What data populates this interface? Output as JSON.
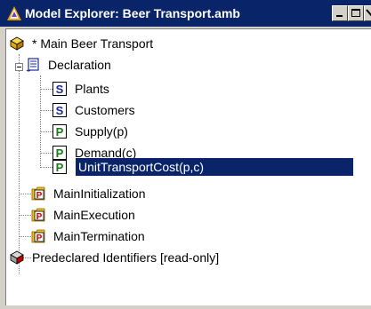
{
  "window": {
    "title": "Model Explorer: Beer Transport.amb",
    "title_icon": "aimms-model-icon"
  },
  "tree": {
    "root": {
      "label": "* Main Beer Transport",
      "icon": "model-box-icon"
    },
    "declaration": {
      "label": "Declaration",
      "icon": "declaration-scroll-icon",
      "expanded": true,
      "items": [
        {
          "label": "Plants",
          "badge": "S",
          "badge_color": "#1b2a9a"
        },
        {
          "label": "Customers",
          "badge": "S",
          "badge_color": "#1b2a9a"
        },
        {
          "label": "Supply(p)",
          "badge": "P",
          "badge_color": "#1a7a1a"
        },
        {
          "label": "Demand(c)",
          "badge": "P",
          "badge_color": "#1a7a1a"
        },
        {
          "label": "UnitTransportCost(p,c)",
          "badge": "P",
          "badge_color": "#1a7a1a",
          "selected": true
        }
      ]
    },
    "procedures": [
      {
        "label": "MainInitialization",
        "badge": "P"
      },
      {
        "label": "MainExecution",
        "badge": "P"
      },
      {
        "label": "MainTermination",
        "badge": "P"
      }
    ],
    "predeclared": {
      "label": "Predeclared Identifiers [read-only]",
      "icon": "predeclared-box-icon"
    }
  },
  "colors": {
    "title_bar": "#0a246a",
    "selection": "#0a246a",
    "set_badge": "#1b2a9a",
    "parameter_badge": "#1a7a1a",
    "procedure_badge": "#c00000",
    "folder": "#f0c020"
  }
}
